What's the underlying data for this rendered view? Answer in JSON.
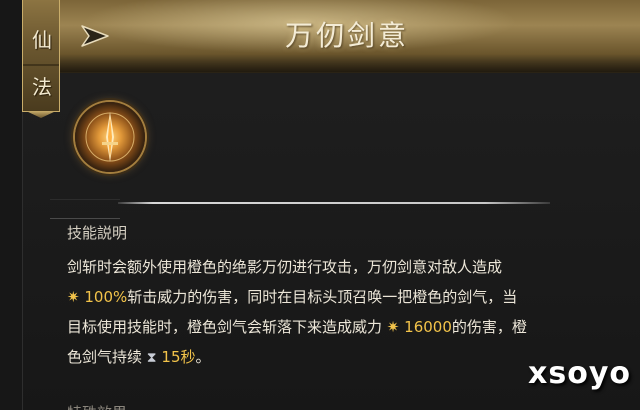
{
  "header": {
    "title": "万仞剑意",
    "category_tab": [
      "仙",
      "法"
    ]
  },
  "skill": {
    "icon": "sword-skill-icon",
    "section_title": "技能説明",
    "description": {
      "line1": "剑斩时会额外使用橙色的绝影万仞进行攻击，万仞剑意对敌人造成",
      "damage_percent": "100%",
      "line2_after": "斩击威力的伤害，同时在目标头顶召唤一把橙色的剑气，当",
      "line3_before": "目标使用技能时，橙色剑气会斩落下来造成威力",
      "power_value": "16000",
      "line3_after": "的伤害，橙",
      "line4_before": "色剑气持续",
      "duration": "15秒",
      "line4_end": "。"
    },
    "next_section_title": "特殊效果"
  },
  "watermark": "xsoyo",
  "colors": {
    "highlight": "#f2c34a",
    "header_gold": "#9c8452",
    "panel_bg": "#1b1b1b"
  }
}
